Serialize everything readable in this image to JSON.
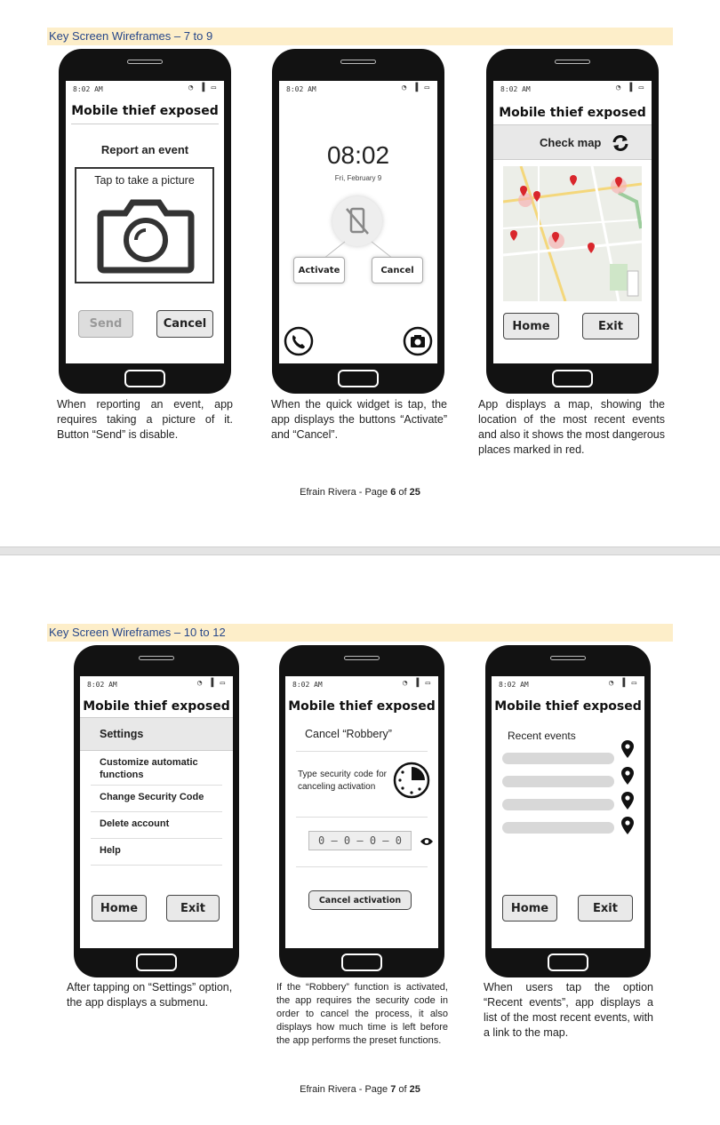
{
  "page1": {
    "header": "Key Screen Wireframes – 7 to 9",
    "status_time": "8:02 AM",
    "screen7": {
      "title": "Mobile thief exposed",
      "heading": "Report an event",
      "picture_label": "Tap to take a picture",
      "send_label": "Send",
      "cancel_label": "Cancel",
      "caption": "When reporting an event, app requires taking a picture of it. Button “Send” is disable."
    },
    "screen8": {
      "clock": "08:02",
      "date": "Fri, February 9",
      "activate_label": "Activate",
      "cancel_label": "Cancel",
      "caption": "When the quick widget is tap, the app displays the buttons “Activate” and “Cancel”."
    },
    "screen9": {
      "title": "Mobile thief exposed",
      "check_map_label": "Check map",
      "home_label": "Home",
      "exit_label": "Exit",
      "caption": "App displays a map, showing the location of the most recent events and also it shows the most dangerous places marked in red."
    },
    "footer": {
      "prefix": "Efrain Rivera - Page ",
      "page": "6",
      "of": " of ",
      "total": "25"
    }
  },
  "page2": {
    "header": "Key Screen Wireframes – 10 to 12",
    "status_time": "8:02 AM",
    "screen10": {
      "title": "Mobile thief exposed",
      "settings_label": "Settings",
      "items": [
        "Customize automatic functions",
        "Change Security Code",
        "Delete account",
        "Help"
      ],
      "home_label": "Home",
      "exit_label": "Exit",
      "caption": "After tapping on “Settings” option, the app displays a submenu."
    },
    "screen11": {
      "title": "Mobile thief exposed",
      "subtitle": "Cancel “Robbery”",
      "instructions": "Type security code for canceling activation",
      "code_value": "0 – 0 – 0 – 0",
      "cancel_activation_label": "Cancel activation",
      "caption": "If the “Robbery” function is activated, the app requires the security code in order to cancel the process, it also displays how much time is left before the app performs the preset functions."
    },
    "screen12": {
      "title": "Mobile thief exposed",
      "recent_label": "Recent events",
      "home_label": "Home",
      "exit_label": "Exit",
      "caption": "When users tap the option “Recent events”, app displays a list of the most recent events, with a link to the map."
    },
    "footer": {
      "prefix": "Efrain Rivera - Page ",
      "page": "7",
      "of": " of ",
      "total": "25"
    }
  }
}
